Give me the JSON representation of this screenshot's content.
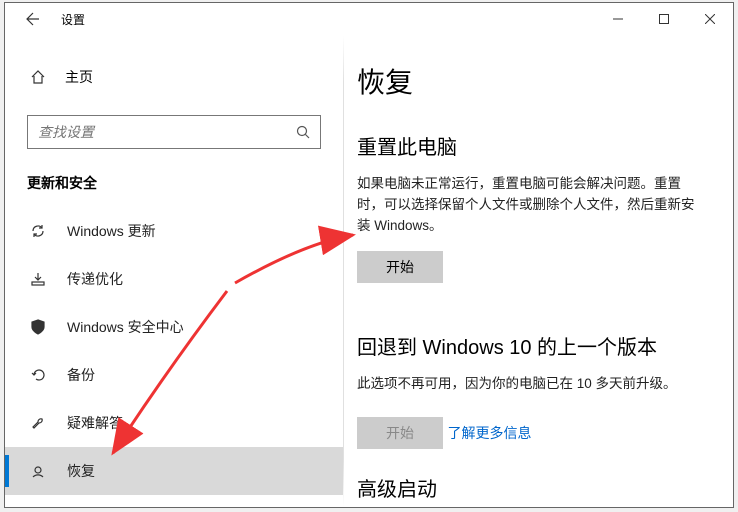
{
  "titlebar": {
    "title": "设置"
  },
  "sidebar": {
    "home": "主页",
    "search_placeholder": "查找设置",
    "section": "更新和安全",
    "items": [
      {
        "icon": "sync",
        "label": "Windows 更新"
      },
      {
        "icon": "delivery",
        "label": "传递优化"
      },
      {
        "icon": "shield",
        "label": "Windows 安全中心"
      },
      {
        "icon": "backup",
        "label": "备份"
      },
      {
        "icon": "trouble",
        "label": "疑难解答"
      },
      {
        "icon": "recovery",
        "label": "恢复"
      }
    ],
    "selected_index": 5
  },
  "content": {
    "heading": "恢复",
    "reset": {
      "title": "重置此电脑",
      "desc": "如果电脑未正常运行，重置电脑可能会解决问题。重置时，可以选择保留个人文件或删除个人文件，然后重新安装 Windows。",
      "button": "开始"
    },
    "rollback": {
      "title": "回退到 Windows 10 的上一个版本",
      "desc": "此选项不再可用，因为你的电脑已在 10 多天前升级。",
      "button": "开始"
    },
    "learn_more": "了解更多信息",
    "advanced": "高级启动"
  }
}
